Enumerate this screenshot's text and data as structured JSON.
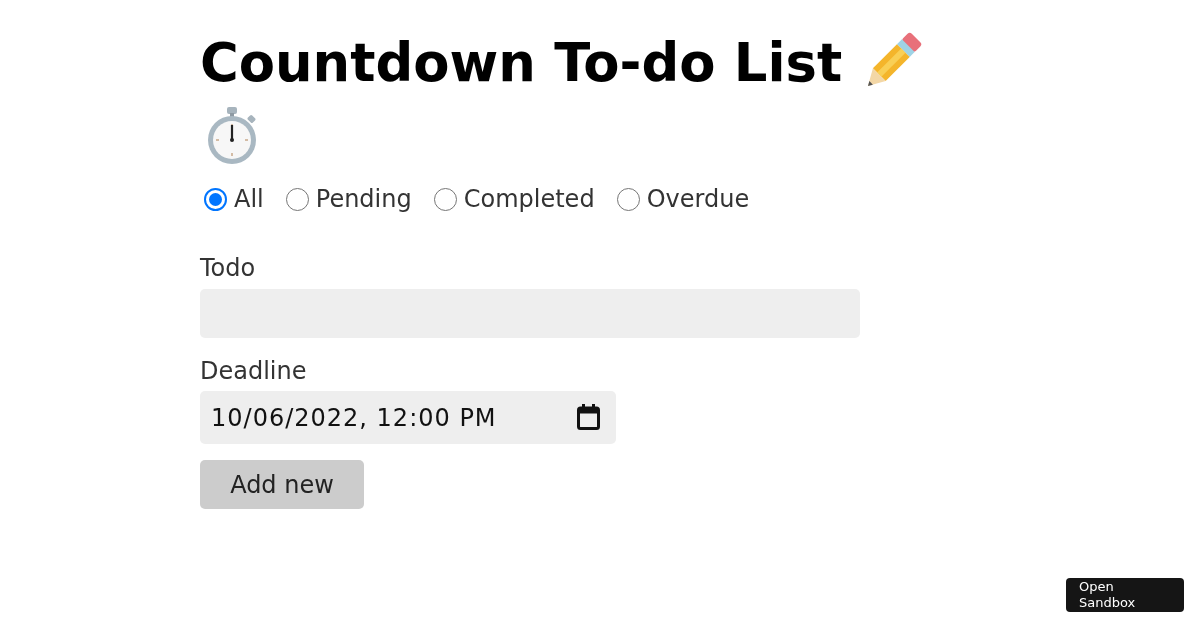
{
  "title": "Countdown To-do List",
  "filters": [
    {
      "label": "All",
      "selected": true
    },
    {
      "label": "Pending",
      "selected": false
    },
    {
      "label": "Completed",
      "selected": false
    },
    {
      "label": "Overdue",
      "selected": false
    }
  ],
  "form": {
    "todo": {
      "label": "Todo"
    },
    "deadline": {
      "label": "Deadline",
      "value": "10/06/2022, 12:00 PM"
    },
    "submit": "Add new"
  },
  "open_sandbox": "Open Sandbox"
}
